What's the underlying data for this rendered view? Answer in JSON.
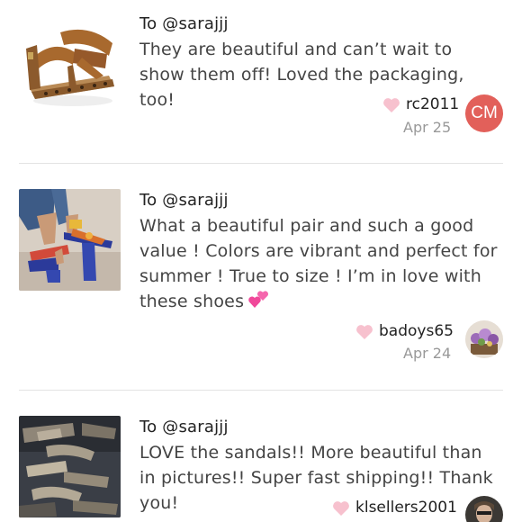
{
  "reviews": [
    {
      "to": "To @sarajjj",
      "text": "They are beautiful and can’t wait to show them off! Loved the packaging, too!",
      "username": "rc2011",
      "date": "Apr 25",
      "avatar_initials": "CM",
      "avatar_color": "#e2605a",
      "image": "brown-strappy-sandal-leopard-sole"
    },
    {
      "to": "To @sarajjj",
      "text": "What a beautiful pair and such a good value ! Colors are vibrant and perfect for summer ! True to size ! I’m in love with these shoes",
      "emoji": "two-hearts-emoji",
      "username": "badoys65",
      "date": "Apr 24",
      "image": "colorful-block-heel-sandals-on-feet"
    },
    {
      "to": "To @sarajjj",
      "text": "LOVE the sandals!! More beautiful than in pictures!! Super fast shipping!! Thank you!",
      "username": "klsellers2001",
      "image": "glitter-strap-sandals-in-box"
    }
  ],
  "colors": {
    "heart": "#f7c1ce",
    "divider": "#e3e3e3",
    "date": "#999999"
  }
}
